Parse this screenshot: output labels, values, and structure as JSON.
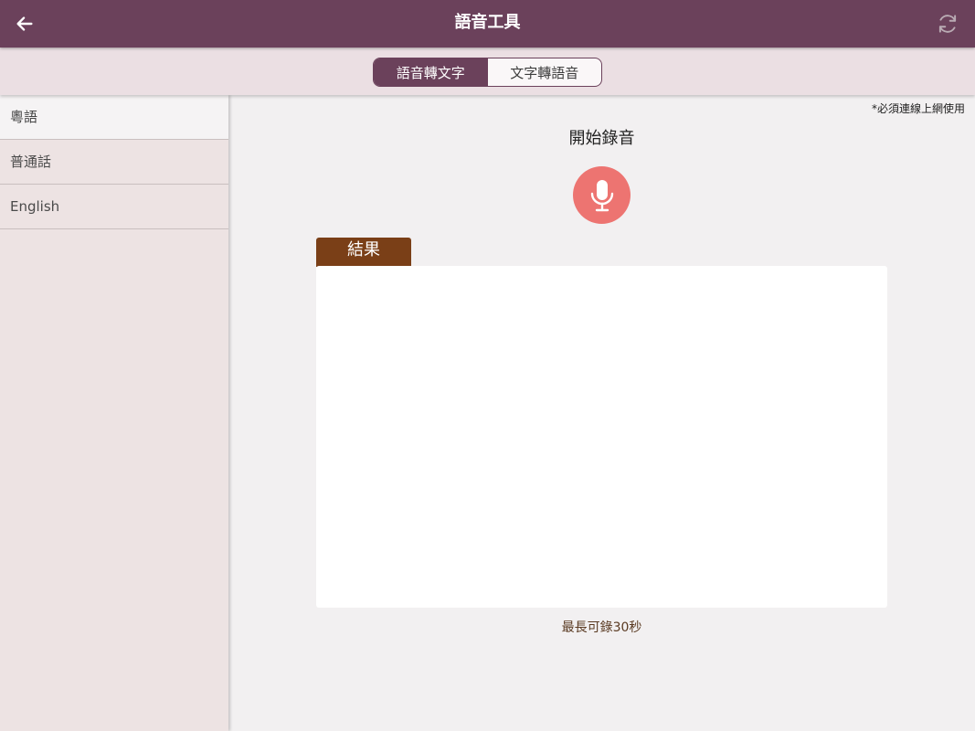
{
  "header": {
    "title": "語音工具",
    "back_icon": "arrow-left-icon",
    "refresh_icon": "refresh-icon"
  },
  "tabs": [
    {
      "label": "語音轉文字",
      "active": true
    },
    {
      "label": "文字轉語音",
      "active": false
    }
  ],
  "sidebar": {
    "items": [
      {
        "label": "粵語",
        "active": true
      },
      {
        "label": "普通話",
        "active": false
      },
      {
        "label": "English",
        "active": false
      }
    ]
  },
  "main": {
    "online_note": "*必須連線上網使用",
    "record_label": "開始錄音",
    "mic_icon": "microphone-icon",
    "result_tab": "結果",
    "result_text": "",
    "max_note": "最長可錄30秒"
  },
  "colors": {
    "header": "#6b415b",
    "mic": "#ed7471",
    "result_tab": "#7a3f17"
  }
}
